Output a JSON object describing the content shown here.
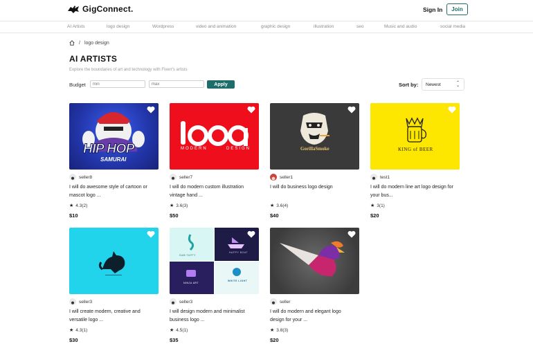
{
  "header": {
    "brand": "GigConnect.",
    "signin_label": "Sign In",
    "join_label": "Join"
  },
  "categories": [
    "AI Artists",
    "logo design",
    "Wordpress",
    "video and animation",
    "graphic design",
    "illustration",
    "seo",
    "Music and audio",
    "social media"
  ],
  "breadcrumb": {
    "separator": "/",
    "current": "logo design"
  },
  "page": {
    "title": "AI ARTISTS",
    "subtitle": "Explore the boundaries of art and technology with Fiverr's artists"
  },
  "filters": {
    "budget_label": "Budget",
    "min_placeholder": "min",
    "max_placeholder": "max",
    "apply_label": "Apply",
    "sort_label": "Sort by:",
    "sort_value": "Newest"
  },
  "gigs": [
    {
      "seller": "seller8",
      "title": "I will do awesome style of cartoon or mascot logo ...",
      "rating": "4.3",
      "reviews": "(2)",
      "price": "$10",
      "art_text1": "HIP HOP",
      "art_text2": "SAMURAI"
    },
    {
      "seller": "seller7",
      "title": "I will do modern custom illustration vintage hand ...",
      "rating": "3.6",
      "reviews": "(3)",
      "price": "$50",
      "art_text1": "MODERN",
      "art_text2": "DESIGN"
    },
    {
      "seller": "seller1",
      "title": "I will do business logo design",
      "rating": "3.6",
      "reviews": "(4)",
      "price": "$40",
      "art_text1": "GorillaSmoke"
    },
    {
      "seller": "test1",
      "title": "I will do modern line art logo design for your bus...",
      "rating": "3",
      "reviews": "(1)",
      "price": "$20",
      "art_text1": "KING of BEER"
    },
    {
      "seller": "seller3",
      "title": "I will create modern, creative and versatile logo ...",
      "rating": "4.3",
      "reviews": "(1)",
      "price": "$30"
    },
    {
      "seller": "seller3",
      "title": "I will design modern and minimalist business logo ...",
      "rating": "4.5",
      "reviews": "(1)",
      "price": "$35",
      "art_text1": "SAM TAFFY",
      "art_text2": "HAPPY BOAT",
      "art_text3": "NINJA ART",
      "art_text4": "WHITE LIGHT"
    },
    {
      "seller": "seller",
      "title": "I will do modern and elegant logo design for your ...",
      "rating": "3.8",
      "reviews": "(3)",
      "price": "$20"
    }
  ],
  "colors": {
    "accent": "#1f6d6b",
    "card1_bg": "#2a3fb8",
    "card2_bg": "#ee0e1c",
    "card3_bg": "#3a3a3a",
    "card4_bg": "#fde600",
    "card5_bg": "#22d3ec",
    "card7_bg": "#4a4a4a"
  }
}
